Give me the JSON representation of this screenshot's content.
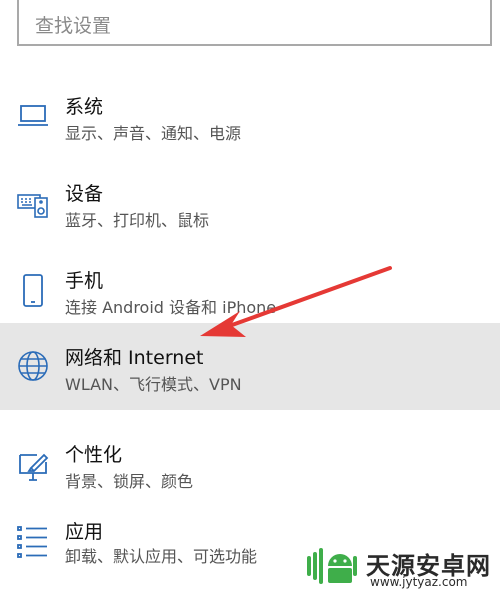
{
  "search": {
    "placeholder": "查找设置"
  },
  "items": [
    {
      "title": "系统",
      "subtitle": "显示、声音、通知、电源",
      "icon": "laptop-icon"
    },
    {
      "title": "设备",
      "subtitle": "蓝牙、打印机、鼠标",
      "icon": "devices-icon"
    },
    {
      "title": "手机",
      "subtitle": "连接 Android 设备和 iPhone",
      "icon": "phone-icon"
    },
    {
      "title": "网络和 Internet",
      "subtitle": "WLAN、飞行模式、VPN",
      "icon": "globe-icon",
      "selected": true
    },
    {
      "title": "个性化",
      "subtitle": "背景、锁屏、颜色",
      "icon": "personalization-icon"
    },
    {
      "title": "应用",
      "subtitle": "卸载、默认应用、可选功能",
      "icon": "apps-list-icon"
    }
  ],
  "colors": {
    "icon": "#2b6cb8",
    "selected_bg": "#e6e6e6",
    "arrow": "#e53935"
  },
  "watermark": {
    "name": "天源安卓网",
    "url": "www.jytyaz.com"
  }
}
